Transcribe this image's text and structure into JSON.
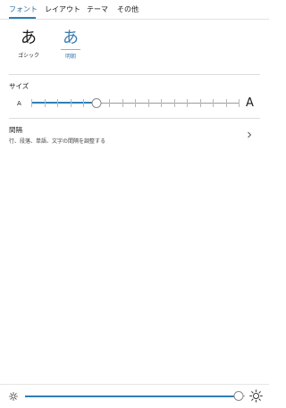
{
  "tabs": [
    {
      "label": "フォント",
      "active": true
    },
    {
      "label": "レイアウト",
      "active": false
    },
    {
      "label": "テーマ",
      "active": false
    },
    {
      "label": "その他",
      "active": false
    }
  ],
  "fonts": [
    {
      "glyph": "あ",
      "label": "ゴシック",
      "selected": false
    },
    {
      "glyph": "あ",
      "label": "明朝",
      "selected": true
    }
  ],
  "size": {
    "title": "サイズ",
    "small_label": "A",
    "large_label": "A",
    "steps": 17,
    "current_step": 5
  },
  "spacing": {
    "title": "間隔",
    "description": "行、段落、単語、文字の間隔を調整する"
  },
  "brightness": {
    "level": 0.97
  },
  "colors": {
    "accent": "#2f7fb5",
    "selected_text": "#3a7cb0",
    "divider": "#dcdcdc"
  },
  "icons": {
    "spacing_chevron": "chevron-right-icon",
    "brightness_low": "sun-small-icon",
    "brightness_high": "sun-large-icon"
  }
}
